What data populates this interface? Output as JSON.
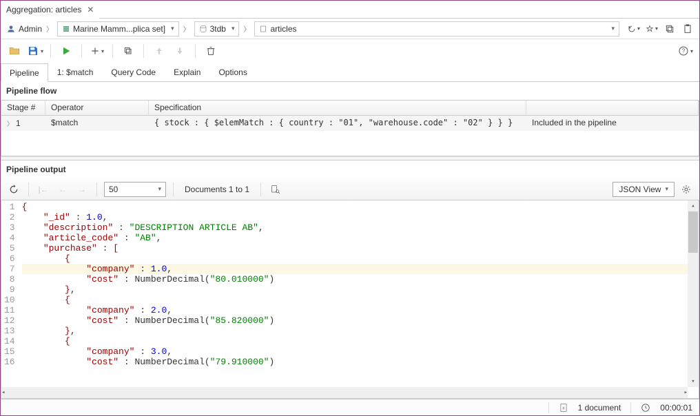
{
  "docTab": {
    "title": "Aggregation: articles"
  },
  "breadcrumb": {
    "user": "Admin",
    "cluster": "Marine Mamm...plica set]",
    "db": "3tdb",
    "collection": "articles"
  },
  "subTabs": {
    "pipeline": "Pipeline",
    "match": "1: $match",
    "queryCode": "Query Code",
    "explain": "Explain",
    "options": "Options"
  },
  "pipelineFlow": {
    "title": "Pipeline flow",
    "headers": {
      "stage": "Stage #",
      "operator": "Operator",
      "spec": "Specification",
      "included": ""
    },
    "rows": [
      {
        "stage": "1",
        "operator": "$match",
        "spec": "{ stock : { $elemMatch : { country : \"01\", \"warehouse.code\" : \"02\" } } }",
        "included": "Included in the pipeline"
      }
    ]
  },
  "output": {
    "title": "Pipeline output",
    "pageSize": "50",
    "docRange": "Documents 1 to 1",
    "viewMode": "JSON View"
  },
  "code": {
    "lines": [
      {
        "n": 1,
        "html": "<span class='br'>{</span>"
      },
      {
        "n": 2,
        "html": "    <span class='key'>\"_id\"</span> : <span class='num'>1.0</span>,"
      },
      {
        "n": 3,
        "html": "    <span class='key'>\"description\"</span> : <span class='str'>\"DESCRIPTION ARTICLE AB\"</span>,"
      },
      {
        "n": 4,
        "html": "    <span class='key'>\"article_code\"</span> : <span class='str'>\"AB\"</span>,"
      },
      {
        "n": 5,
        "html": "    <span class='key'>\"purchase\"</span> : <span class='br'>[</span>"
      },
      {
        "n": 6,
        "html": "        <span class='br'>{</span>"
      },
      {
        "n": 7,
        "html": "            <span class='key'>\"company\"</span> : <span class='num'>1.0</span>,",
        "hl": true
      },
      {
        "n": 8,
        "html": "            <span class='key'>\"cost\"</span> : <span class='fn'>NumberDecimal(</span><span class='str'>\"80.010000\"</span><span class='fn'>)</span>"
      },
      {
        "n": 9,
        "html": "        <span class='br'>}</span>,"
      },
      {
        "n": 10,
        "html": "        <span class='br'>{</span>"
      },
      {
        "n": 11,
        "html": "            <span class='key'>\"company\"</span> : <span class='num'>2.0</span>,"
      },
      {
        "n": 12,
        "html": "            <span class='key'>\"cost\"</span> : <span class='fn'>NumberDecimal(</span><span class='str'>\"85.820000\"</span><span class='fn'>)</span>"
      },
      {
        "n": 13,
        "html": "        <span class='br'>}</span>,"
      },
      {
        "n": 14,
        "html": "        <span class='br'>{</span>"
      },
      {
        "n": 15,
        "html": "            <span class='key'>\"company\"</span> : <span class='num'>3.0</span>,"
      },
      {
        "n": 16,
        "html": "            <span class='key'>\"cost\"</span> : <span class='fn'>NumberDecimal(</span><span class='str'>\"79.910000\"</span><span class='fn'>)</span>"
      }
    ]
  },
  "status": {
    "docs": "1 document",
    "time": "00:00:01"
  }
}
